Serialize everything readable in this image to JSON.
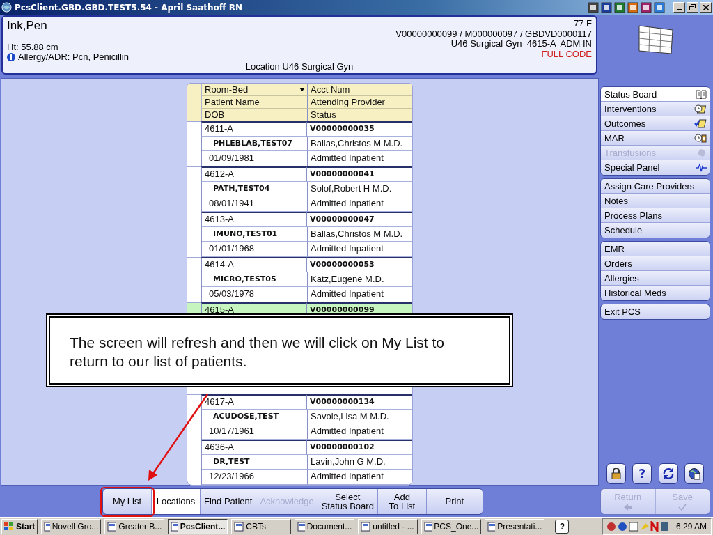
{
  "window": {
    "title": "PcsClient.GBD.GBD.TEST5.54 - April Saathoff RN"
  },
  "patient_banner": {
    "name": "Ink,Pen",
    "height": "Ht: 55.88 cm",
    "allergy": "Allergy/ADR: Pcn, Penicillin",
    "location": "Location U46 Surgical Gyn",
    "age_sex": "77 F",
    "ids": "V00000000099 / M000000097 / GBDVD0000117",
    "unit_bed": "U46 Surgical Gyn  4615-A  ADM IN",
    "code_status": "FULL CODE"
  },
  "patient_list": {
    "header_rows": [
      [
        "Room-Bed",
        "Acct Num"
      ],
      [
        "Patient Name",
        "Attending Provider"
      ],
      [
        "DOB",
        "Status"
      ]
    ],
    "patients": [
      {
        "room": "4611-A",
        "account": "V00000000035",
        "name": "PHLEBLAB,TEST07",
        "provider": "Ballas,Christos M M.D.",
        "dob": "01/09/1981",
        "status": "Admitted Inpatient",
        "selected": false
      },
      {
        "room": "4612-A",
        "account": "V00000000041",
        "name": "PATH,TEST04",
        "provider": "Solof,Robert H M.D.",
        "dob": "08/01/1941",
        "status": "Admitted Inpatient",
        "selected": false
      },
      {
        "room": "4613-A",
        "account": "V00000000047",
        "name": "IMUNO,TEST01",
        "provider": "Ballas,Christos M M.D.",
        "dob": "01/01/1968",
        "status": "Admitted Inpatient",
        "selected": false
      },
      {
        "room": "4614-A",
        "account": "V00000000053",
        "name": "MICRO,TEST05",
        "provider": "Katz,Eugene M.D.",
        "dob": "05/03/1978",
        "status": "Admitted Inpatient",
        "selected": false
      },
      {
        "room": "4615-A",
        "account": "V00000000099",
        "selected": true
      }
    ],
    "patients_after_note": [
      {
        "room": "4617-A",
        "account": "V00000000134",
        "name": "ACUDOSE,TEST",
        "provider": "Savoie,Lisa M M.D.",
        "dob": "10/17/1961",
        "status": "Admitted Inpatient",
        "selected": false
      },
      {
        "room": "4636-A",
        "account": "V00000000102",
        "name": "DR,TEST",
        "provider": "Lavin,John G M.D.",
        "dob": "12/23/1966",
        "status": "Admitted Inpatient",
        "selected": false
      }
    ]
  },
  "callout": {
    "text": "The screen will refresh and then we will click on My List to return to our list of patients."
  },
  "sidebar": {
    "groups": [
      [
        {
          "label": "Status Board",
          "selected": true,
          "disabled": false
        },
        {
          "label": "Interventions",
          "selected": false,
          "disabled": false
        },
        {
          "label": "Outcomes",
          "selected": false,
          "disabled": false
        },
        {
          "label": "MAR",
          "selected": false,
          "disabled": false
        },
        {
          "label": "Transfusions",
          "selected": false,
          "disabled": true
        },
        {
          "label": "Special Panel",
          "selected": false,
          "disabled": false
        }
      ],
      [
        {
          "label": "Assign Care Providers",
          "selected": false,
          "disabled": false
        },
        {
          "label": "Notes",
          "selected": false,
          "disabled": false
        },
        {
          "label": "Process Plans",
          "selected": false,
          "disabled": false
        },
        {
          "label": "Schedule",
          "selected": false,
          "disabled": false
        }
      ],
      [
        {
          "label": "EMR",
          "selected": false,
          "disabled": false
        },
        {
          "label": "Orders",
          "selected": false,
          "disabled": false
        },
        {
          "label": "Allergies",
          "selected": false,
          "disabled": false
        },
        {
          "label": "Historical Meds",
          "selected": false,
          "disabled": false
        }
      ],
      [
        {
          "label": "Exit PCS",
          "selected": false,
          "disabled": false
        }
      ]
    ]
  },
  "quick_buttons": {
    "help": "?"
  },
  "action_buttons": [
    {
      "label": "Return",
      "disabled": true
    },
    {
      "label": "Save",
      "disabled": true
    }
  ],
  "toolbar": {
    "buttons": [
      {
        "label": "My List",
        "selected": false,
        "disabled": false
      },
      {
        "label": "Locations",
        "selected": true,
        "disabled": false
      },
      {
        "label": "Find Patient",
        "selected": false,
        "disabled": false
      },
      {
        "label": "Acknowledge",
        "selected": false,
        "disabled": true
      },
      {
        "label": "Select\nStatus Board",
        "selected": false,
        "disabled": false
      },
      {
        "label": "Add\nTo List",
        "selected": false,
        "disabled": false
      },
      {
        "label": "Print",
        "selected": false,
        "disabled": false
      }
    ]
  },
  "taskbar": {
    "start": "Start",
    "tasks": [
      {
        "label": "Novell Gro...",
        "selected": false
      },
      {
        "label": "Greater B...",
        "selected": false
      },
      {
        "label": "PcsClient...",
        "selected": true
      },
      {
        "label": "CBTs",
        "selected": false
      },
      {
        "label": "Document...",
        "selected": false
      },
      {
        "label": "untitled - ...",
        "selected": false
      },
      {
        "label": "PCS_One...",
        "selected": false
      },
      {
        "label": "Presentati...",
        "selected": false
      }
    ],
    "help": "?",
    "clock": "6:29 AM"
  }
}
